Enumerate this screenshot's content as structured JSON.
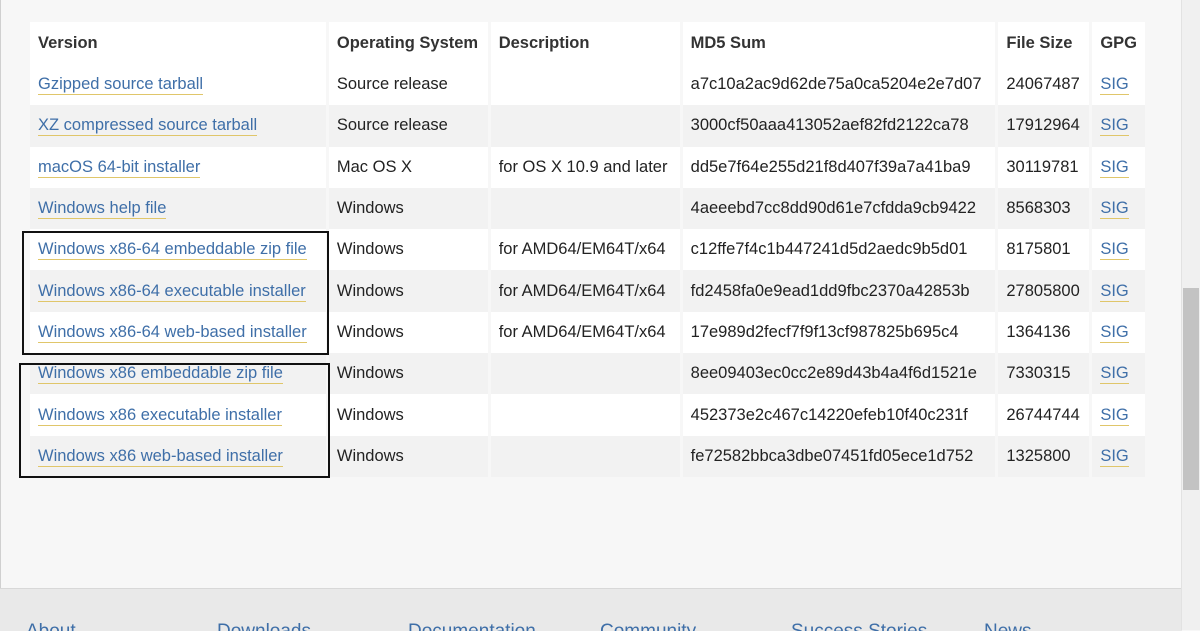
{
  "table": {
    "headers": [
      "Version",
      "Operating System",
      "Description",
      "MD5 Sum",
      "File Size",
      "GPG"
    ],
    "rows": [
      {
        "version": "Gzipped source tarball",
        "os": "Source release",
        "description": "",
        "md5": "a7c10a2ac9d62de75a0ca5204e2e7d07",
        "size": "24067487",
        "gpg": "SIG"
      },
      {
        "version": "XZ compressed source tarball",
        "os": "Source release",
        "description": "",
        "md5": "3000cf50aaa413052aef82fd2122ca78",
        "size": "17912964",
        "gpg": "SIG"
      },
      {
        "version": "macOS 64-bit installer",
        "os": "Mac OS X",
        "description": "for OS X 10.9 and later",
        "md5": "dd5e7f64e255d21f8d407f39a7a41ba9",
        "size": "30119781",
        "gpg": "SIG"
      },
      {
        "version": "Windows help file",
        "os": "Windows",
        "description": "",
        "md5": "4aeeebd7cc8dd90d61e7cfdda9cb9422",
        "size": "8568303",
        "gpg": "SIG"
      },
      {
        "version": "Windows x86-64 embeddable zip file",
        "os": "Windows",
        "description": "for AMD64/EM64T/x64",
        "md5": "c12ffe7f4c1b447241d5d2aedc9b5d01",
        "size": "8175801",
        "gpg": "SIG"
      },
      {
        "version": "Windows x86-64 executable installer",
        "os": "Windows",
        "description": "for AMD64/EM64T/x64",
        "md5": "fd2458fa0e9ead1dd9fbc2370a42853b",
        "size": "27805800",
        "gpg": "SIG"
      },
      {
        "version": "Windows x86-64 web-based installer",
        "os": "Windows",
        "description": "for AMD64/EM64T/x64",
        "md5": "17e989d2fecf7f9f13cf987825b695c4",
        "size": "1364136",
        "gpg": "SIG"
      },
      {
        "version": "Windows x86 embeddable zip file",
        "os": "Windows",
        "description": "",
        "md5": "8ee09403ec0cc2e89d43b4a4f6d1521e",
        "size": "7330315",
        "gpg": "SIG"
      },
      {
        "version": "Windows x86 executable installer",
        "os": "Windows",
        "description": "",
        "md5": "452373e2c467c14220efeb10f40c231f",
        "size": "26744744",
        "gpg": "SIG"
      },
      {
        "version": "Windows x86 web-based installer",
        "os": "Windows",
        "description": "",
        "md5": "fe72582bbca3dbe07451fd05ece1d752",
        "size": "1325800",
        "gpg": "SIG"
      }
    ]
  },
  "footer": {
    "items": [
      "About",
      "Downloads",
      "Documentation",
      "Community",
      "Success Stories",
      "News"
    ]
  },
  "colors": {
    "link": "#3f6fa8",
    "link_underline": "#e0c66a",
    "highlight_box": "#111111"
  }
}
